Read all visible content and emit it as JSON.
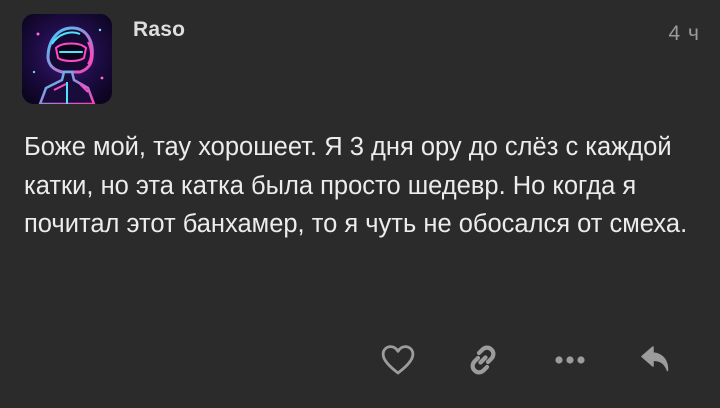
{
  "comment": {
    "author": "Raso",
    "time": "4 ч",
    "text": "Боже мой, тау хорошеет. Я 3 дня ору до слёз с каждой катки, но эта катка была просто шедевр. Но когда я почитал этот банхамер, то я чуть не обосался от смеха."
  },
  "actions": {
    "like_icon": "heart-icon",
    "link_icon": "link-icon",
    "more_icon": "more-dots-icon",
    "reply_icon": "reply-arrow-icon"
  },
  "colors": {
    "background": "#2b2b2b",
    "text": "#ececec",
    "muted": "#9a9a9a",
    "icon": "#9c9c9c"
  }
}
